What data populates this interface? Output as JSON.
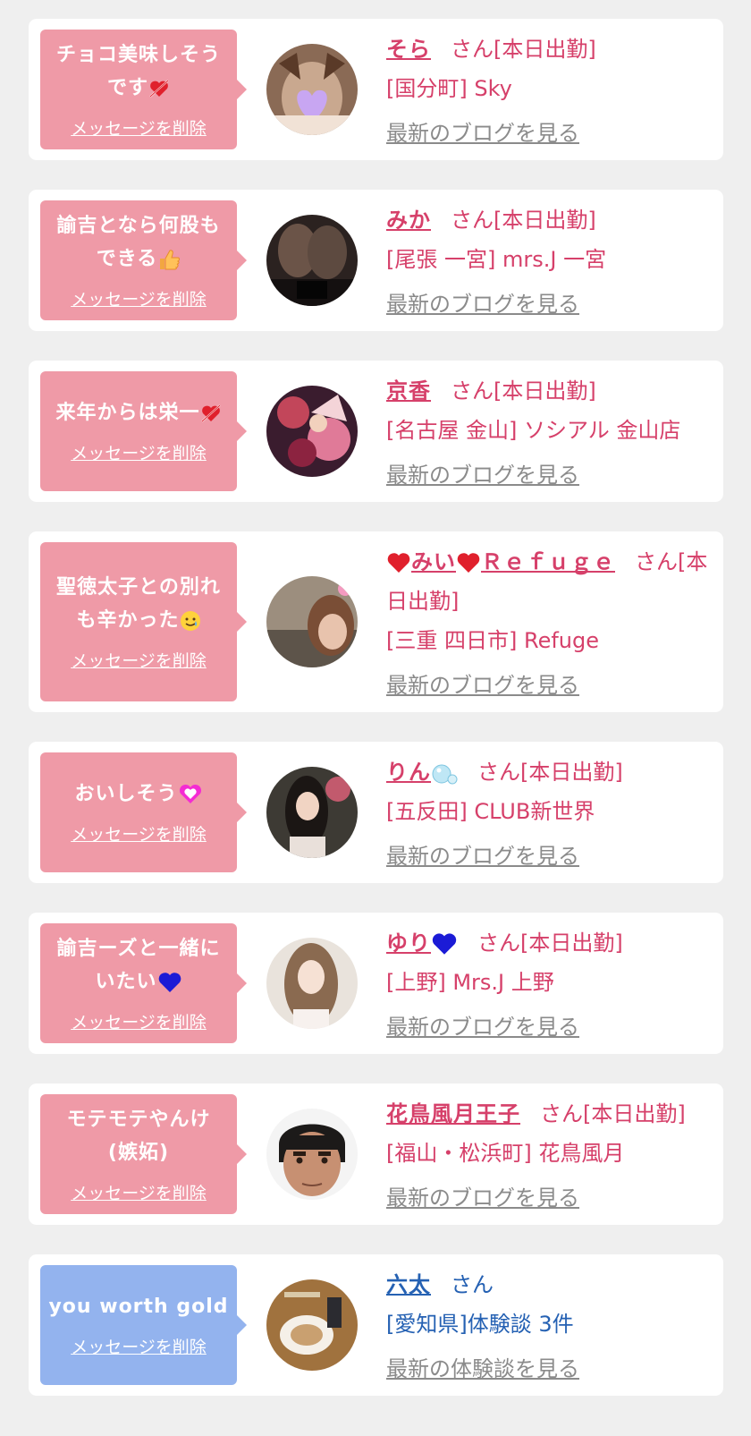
{
  "delete_label": "メッセージを削除",
  "colors": {
    "pink_bubble": "#ef9aa7",
    "blue_bubble": "#93b3ee",
    "pink_text": "#d6406a",
    "blue_text": "#2561b3",
    "link_gray": "#8b8b8b"
  },
  "cards": [
    {
      "message_lines": [
        "チョコ美味しそう",
        "です"
      ],
      "message_icon": "heart-arrow-icon",
      "name": "そら",
      "suffix": "さん[本日出勤]",
      "shop": "[国分町] Sky",
      "link": "最新のブログを見る"
    },
    {
      "message_lines": [
        "諭吉となら何股も",
        "できる"
      ],
      "message_icon": "thumbs-up-icon",
      "name": "みか",
      "suffix": "さん[本日出勤]",
      "shop": "[尾張 一宮] mrs.J 一宮",
      "link": "最新のブログを見る"
    },
    {
      "message_lines": [
        "来年からは栄一"
      ],
      "message_icon": "heart-arrow-icon",
      "name": "京香",
      "suffix": "さん[本日出勤]",
      "shop": "[名古屋 金山] ソシアル 金山店",
      "link": "最新のブログを見る"
    },
    {
      "message_lines": [
        "聖徳太子との別れ",
        "も辛かった"
      ],
      "message_icon": "teary-smile-icon",
      "name": "みいRefuge",
      "name_parts": [
        "みい",
        "Ｒｅｆｕｇｅ"
      ],
      "suffix": "さん[本日出勤]",
      "suffix_lines": [
        "さん[本",
        "日出勤]"
      ],
      "shop": "[三重 四日市] Refuge",
      "link": "最新のブログを見る"
    },
    {
      "message_lines": [
        "おいしそう"
      ],
      "message_icon": "sparkling-heart-icon",
      "name": "りん",
      "name_icon": "bubbles-icon",
      "suffix": "さん[本日出勤]",
      "shop": "[五反田] CLUB新世界",
      "link": "最新のブログを見る"
    },
    {
      "message_lines": [
        "諭吉ーズと一緒に",
        "いたい"
      ],
      "message_icon": "blue-heart-icon",
      "name": "ゆり",
      "name_icon": "blue-heart-icon",
      "suffix": "さん[本日出勤]",
      "shop": "[上野] Mrs.J 上野",
      "link": "最新のブログを見る"
    },
    {
      "message_lines": [
        "モテモテやんけ",
        "(嫉妬)"
      ],
      "name": "花鳥風月王子",
      "suffix": "さん[本日出勤]",
      "shop": "[福山・松浜町] 花鳥風月",
      "link": "最新のブログを見る"
    },
    {
      "message_lines": [
        "you worth gold"
      ],
      "name": "六太",
      "suffix": "さん",
      "shop": "[愛知県]体験談 3件",
      "link": "最新の体験談を見る"
    }
  ]
}
